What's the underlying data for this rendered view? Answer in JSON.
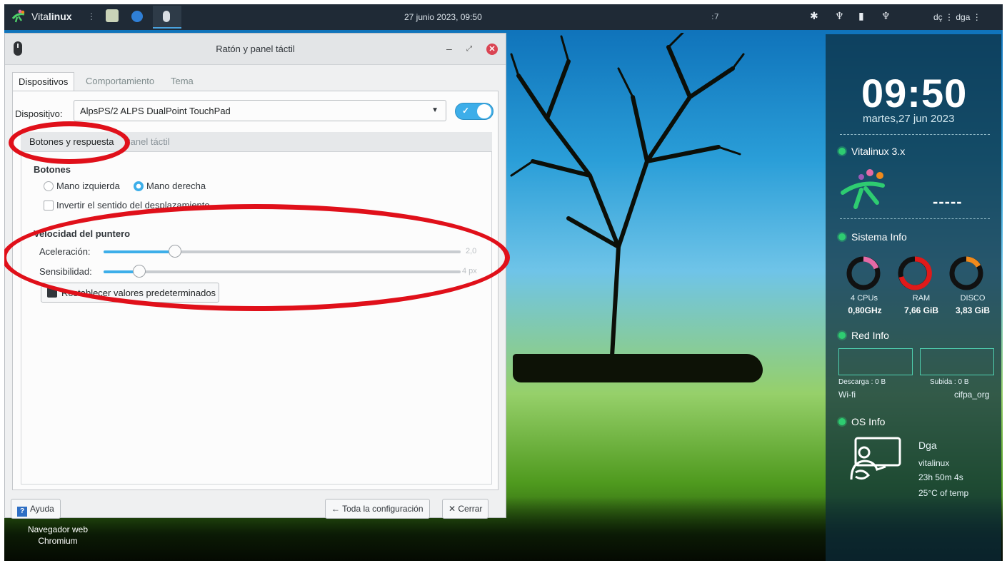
{
  "topbar": {
    "brand_plain": "Vita",
    "brand_bold": "linux",
    "clock": "27 junio 2023, 09:50",
    "misc": ":7",
    "user_left": "dç",
    "user_right": "dga"
  },
  "dialog": {
    "title": "Ratón y panel táctil",
    "tabs": [
      "Dispositivos",
      "Comportamiento",
      "Tema"
    ],
    "device_label_pre": "Disposit",
    "device_label_u": "i",
    "device_label_post": "vo:",
    "device_value": "AlpsPS/2 ALPS DualPoint TouchPad",
    "device_enabled": true,
    "subtabs": [
      "Botones y respuesta",
      "Panel táctil"
    ],
    "buttons_heading": "Botones",
    "left_hand": "Mano izquierda",
    "right_hand": "Mano derecha",
    "invert_scroll": "Invertir el sentido del desplazamiento",
    "pointer_heading": "Velocidad del puntero",
    "accel_label": "Aceleración:",
    "accel_value": "2,0",
    "accel_level": 0.2,
    "sens_label": "Sensibilidad:",
    "sens_value": "4 px",
    "sens_level": 0.1,
    "reset_button": "Restablecer valores predeterminados",
    "help_button": "Ayuda",
    "all_settings_button": "← Toda la configuración",
    "close_button": "✕ Cerrar"
  },
  "desktop": {
    "icon_label_1": "Navegador web",
    "icon_label_2": "Chromium"
  },
  "conky": {
    "time": "09:50",
    "date": "martes,27 jun 2023",
    "distro": "Vitalinux 3.x",
    "placeholder": "-----",
    "system_heading": "Sistema Info",
    "gauges": [
      {
        "label": "4 CPUs",
        "value": "0,80GHz",
        "color": "#e46aa6"
      },
      {
        "label": "RAM",
        "value": "7,66 GiB",
        "color": "#e01a1a"
      },
      {
        "label": "DISCO",
        "value": "3,83 GiB",
        "color": "#f08a1c"
      }
    ],
    "net_heading": "Red Info",
    "download": "Descarga : 0 B",
    "upload": "Subida : 0 B",
    "wifi": "Wi-fi",
    "ssid": "cifpa_org",
    "os_heading": "OS Info",
    "os_name": "Dga",
    "os_host": "vitalinux",
    "uptime": "23h 50m 4s",
    "temp": "25°C of temp"
  },
  "colors": {
    "accent": "#3daee9",
    "annotation": "#e0101a",
    "close": "#da4453"
  }
}
